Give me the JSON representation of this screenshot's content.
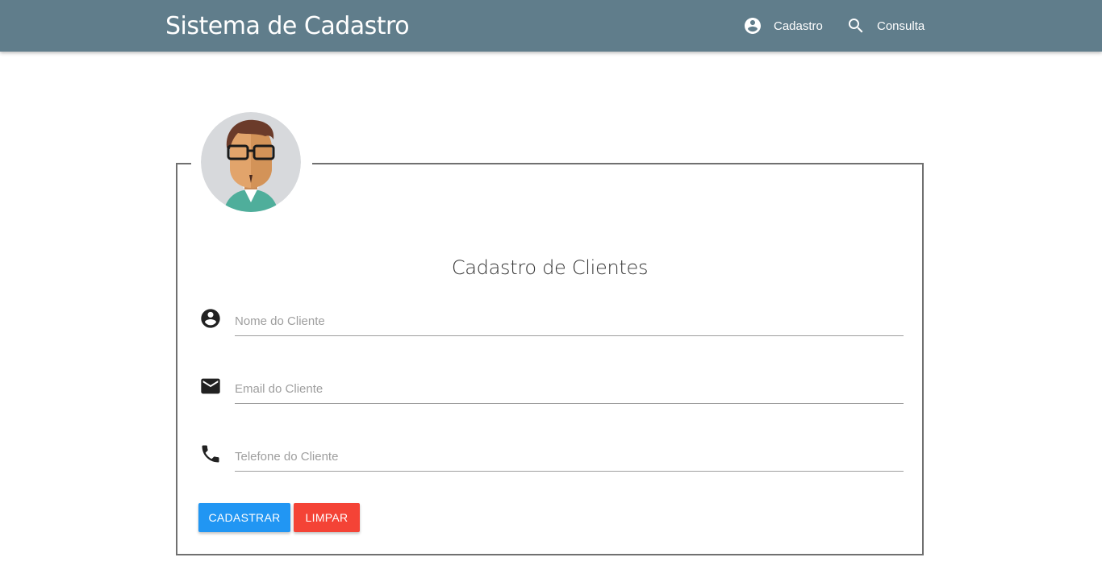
{
  "navbar": {
    "brand": "Sistema de Cadastro",
    "items": [
      {
        "label": "Cadastro",
        "icon": "account-circle-icon"
      },
      {
        "label": "Consulta",
        "icon": "search-icon"
      }
    ],
    "background": "#607d8b"
  },
  "form": {
    "title": "Cadastro de Clientes",
    "fields": [
      {
        "icon": "account-circle-icon",
        "placeholder": "Nome do Cliente",
        "value": ""
      },
      {
        "icon": "email-icon",
        "placeholder": "Email do Cliente",
        "value": ""
      },
      {
        "icon": "phone-icon",
        "placeholder": "Telefone do Cliente",
        "value": ""
      }
    ],
    "buttons": {
      "submit": "Cadastrar",
      "clear": "Limpar"
    },
    "colors": {
      "submit": "#2196f3",
      "clear": "#f44336"
    }
  }
}
